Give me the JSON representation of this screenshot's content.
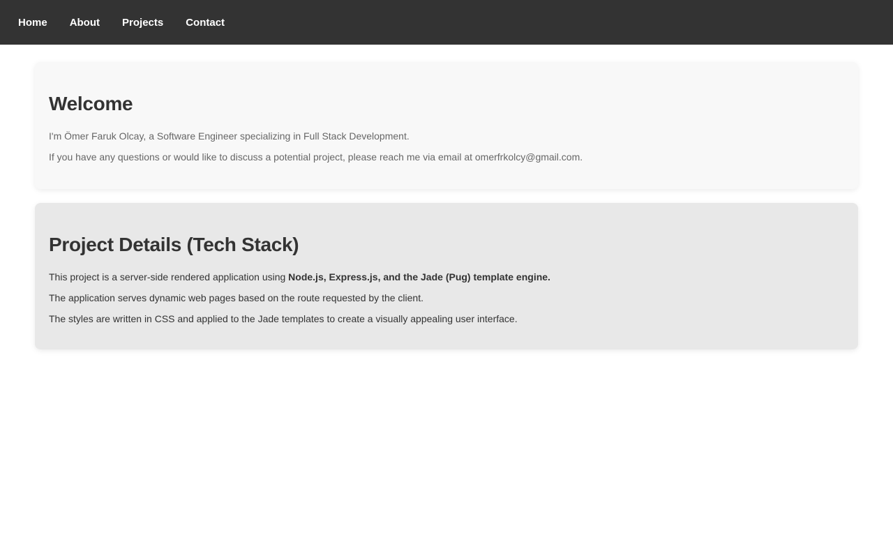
{
  "nav": {
    "items": [
      "Home",
      "About",
      "Projects",
      "Contact"
    ]
  },
  "welcome": {
    "title": "Welcome",
    "lines": [
      "I'm Ömer Faruk Olcay, a Software Engineer specializing in Full Stack Development.",
      "If you have any questions or would like to discuss a potential project, please reach me via email at omerfrkolcy@gmail.com."
    ]
  },
  "project": {
    "title": "Project Details (Tech Stack)",
    "line1_prefix": "This project is a server-side rendered application using ",
    "line1_bold": "Node.js, Express.js, and the Jade (Pug) template engine.",
    "line2": "The application serves dynamic web pages based on the route requested by the client.",
    "line3": "The styles are written in CSS and applied to the Jade templates to create a visually appealing user interface."
  }
}
